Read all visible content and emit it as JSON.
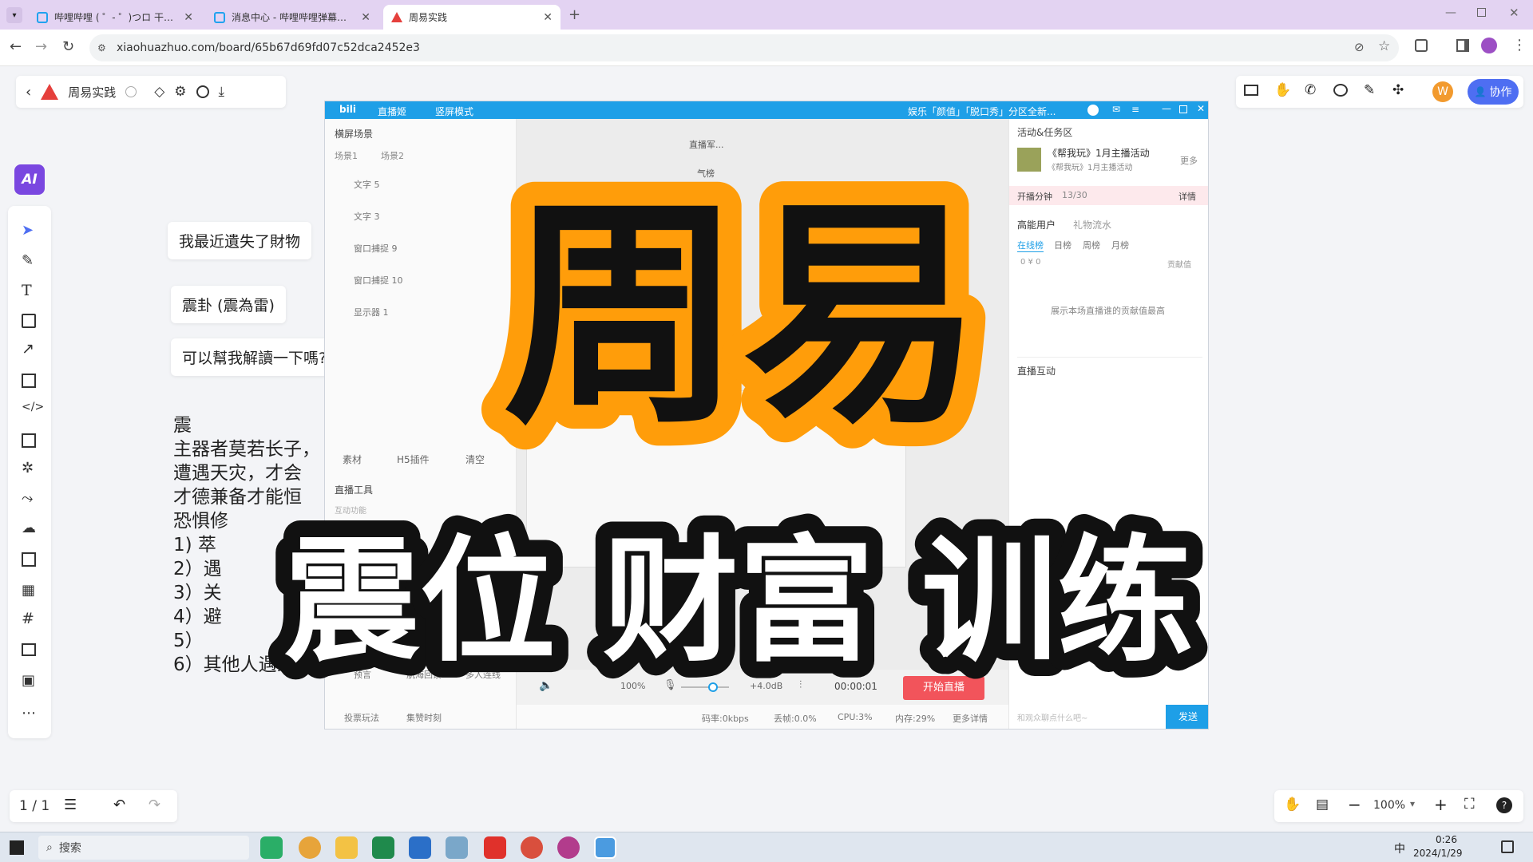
{
  "browser": {
    "tabs": [
      {
        "title": "哔哩哔哩 ( ゜- ゜)つロ 干杯~-bi…",
        "active": false
      },
      {
        "title": "消息中心 - 哔哩哔哩弹幕视频网",
        "active": false
      },
      {
        "title": "周易实践",
        "active": true
      }
    ],
    "url": "xiaohuazhuo.com/board/65b67d69fd07c52dca2452e3"
  },
  "board": {
    "title": "周易实践",
    "ai_label": "AI",
    "avatar_letter": "W",
    "collab_label": "协作",
    "page_indicator": "1 / 1",
    "zoom": "100%"
  },
  "canvas": {
    "bubbles": [
      "我最近遺失了財物",
      "震卦 (震為雷)",
      "可以幫我解讀一下嗎?"
    ],
    "doc_lines": [
      "震",
      "主器者莫若长子，",
      "遭遇天灾，才会",
      "才德兼备才能恒",
      "恐惧修",
      "1) 萃",
      "2）遇",
      "3）关",
      "4）避",
      "5）",
      "6）其他人遇到苦"
    ]
  },
  "obs": {
    "title_left": "直播姬",
    "title_mode": "竖屏模式",
    "title_news": "娱乐「颜值」「脱口秀」分区全新...",
    "scene_header": "横屏场景",
    "scene_tabs": [
      "场景1",
      "场景2"
    ],
    "sources": [
      "文字 5",
      "文字 3",
      "窗口捕捉 9",
      "窗口捕捉 10",
      "显示器 1"
    ],
    "source_actions": [
      "素材",
      "H5插件",
      "清空"
    ],
    "tools_header": "直播工具",
    "tools_sub": "互动功能",
    "tools": [
      "预言",
      "航海回馈",
      "多人连线",
      "投票玩法",
      "集赞时刻"
    ],
    "activity_header": "活动&任务区",
    "activity_title": "《帮我玩》1月主播活动",
    "activity_sub": "《帮我玩》1月主播活动",
    "activity_more": "更多",
    "progress_label": "开播分钟",
    "progress_value": "13/30",
    "progress_detail": "详情",
    "users_tabs": [
      "高能用户",
      "礼物流水"
    ],
    "rank_tabs": [
      "在线榜",
      "日榜",
      "周榜",
      "月榜"
    ],
    "rank_stats": "0  ¥ 0",
    "contrib_label": "贡献值",
    "rank_empty": "展示本场直播谁的贡献值最高",
    "interact_header": "直播互动",
    "volume": "100%",
    "mic_gain": "+4.0dB",
    "timer": "00:00:01",
    "start_button": "开始直播",
    "status_items": [
      "码率:0kbps",
      "丢帧:0.0%",
      "CPU:3%",
      "内存:29%",
      "更多详情"
    ],
    "chat_placeholder": "和观众聊点什么吧~",
    "send_button": "发送",
    "preview_label_1": "直播军...",
    "preview_label_2": "气榜"
  },
  "overlay": {
    "headline": "周易",
    "subtitle_words": [
      "震位",
      "财富",
      "训练"
    ],
    "accent": "#ff9d0a",
    "ink": "#111111"
  },
  "taskbar": {
    "search_placeholder": "搜索",
    "time": "0:26",
    "date": "2024/1/29",
    "ime": "中"
  },
  "colors": {
    "tab_strip": "#e3d3f2",
    "brand_blue": "#4e6ef2",
    "obs_blue": "#1e9fe7",
    "start_red": "#f2545b"
  }
}
